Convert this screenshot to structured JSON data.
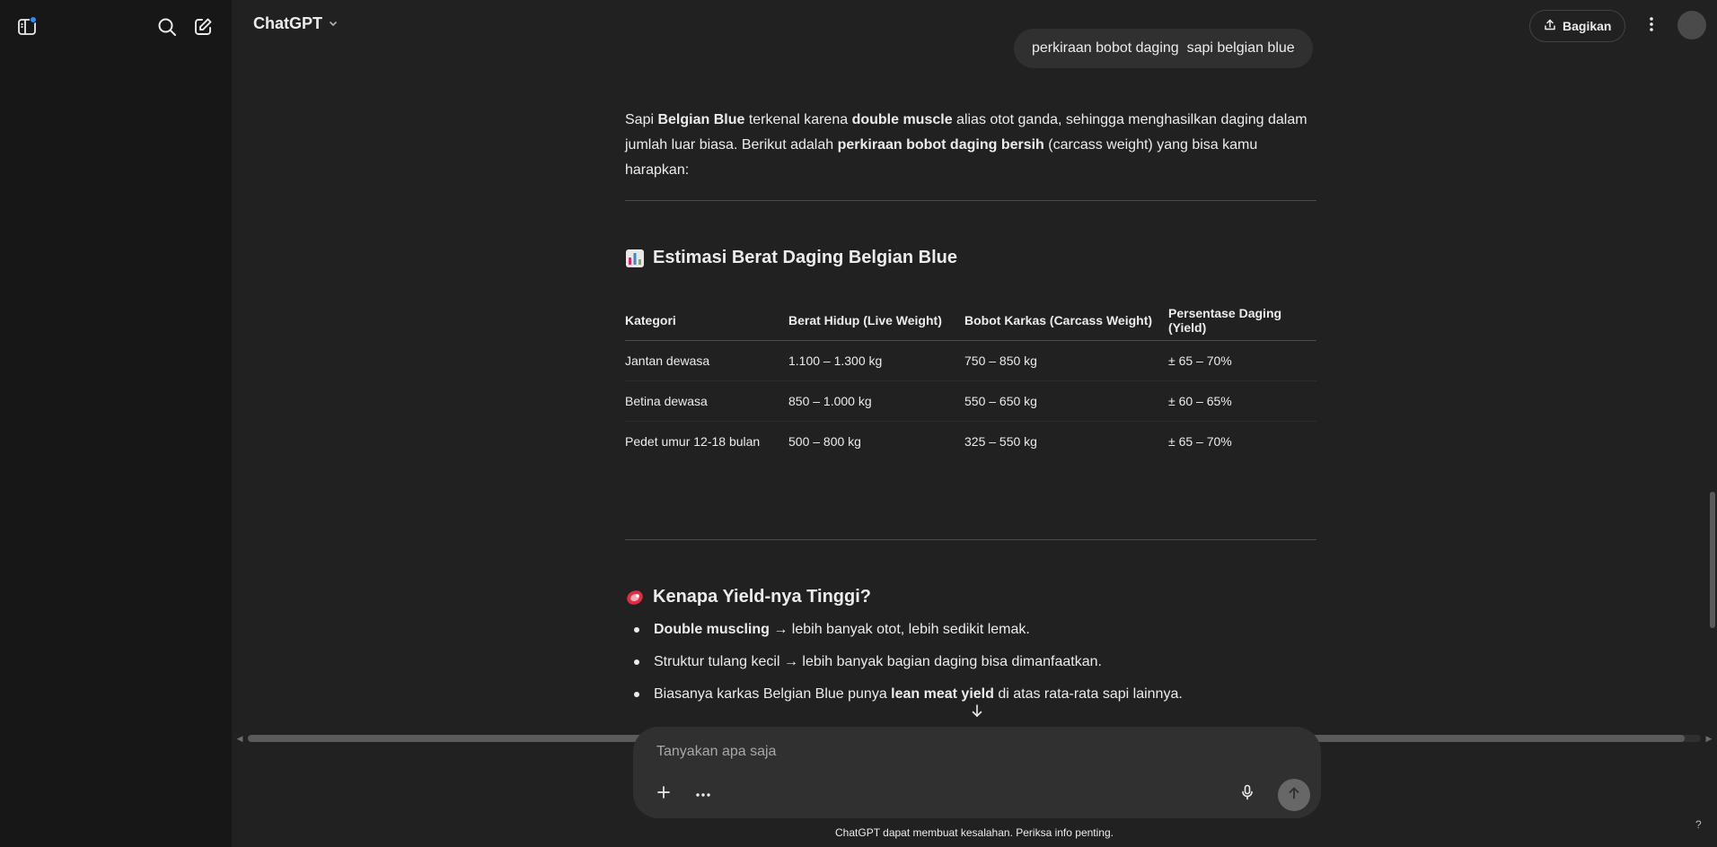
{
  "header": {
    "model_name": "ChatGPT",
    "share_label": "Bagikan"
  },
  "icons": {
    "sidebar_toggle": "sidebar-toggle-icon",
    "search": "search-icon",
    "new_chat": "new-chat-icon",
    "share": "share-icon",
    "more": "more-vertical-icon",
    "plus": "plus-icon",
    "tools": "more-horizontal-icon",
    "mic": "microphone-icon",
    "send": "arrow-up-icon"
  },
  "colors": {
    "background": "#212121",
    "sidebar": "#171717",
    "composer": "#303030",
    "notification_dot": "#2a8cff"
  },
  "user_message": "perkiraan bobot daging  sapi belgian blue",
  "assistant": {
    "intro": {
      "t1": "Sapi ",
      "b1": "Belgian Blue",
      "t2": " terkenal karena ",
      "b2": "double muscle",
      "t3": " alias otot ganda, sehingga menghasilkan daging dalam jumlah luar biasa. Berikut adalah ",
      "b3": "perkiraan bobot daging bersih",
      "t4": " (carcass weight) yang bisa kamu harapkan:"
    },
    "section1": {
      "emoji": "📊",
      "title": "Estimasi Berat Daging Belgian Blue"
    },
    "table": {
      "headers": [
        "Kategori",
        "Berat Hidup (Live Weight)",
        "Bobot Karkas (Carcass Weight)",
        "Persentase Daging (Yield)"
      ],
      "rows": [
        [
          "Jantan dewasa",
          "1.100 – 1.300 kg",
          "750 – 850 kg",
          "± 65 – 70%"
        ],
        [
          "Betina dewasa",
          "850 – 1.000 kg",
          "550 – 650 kg",
          "± 60 – 65%"
        ],
        [
          "Pedet umur 12-18 bulan",
          "500 – 800 kg",
          "325 – 550 kg",
          "± 65 – 70%"
        ]
      ]
    },
    "section2": {
      "emoji": "🥩",
      "title": "Kenapa Yield-nya Tinggi?"
    },
    "reasons": [
      {
        "bold": "Double muscling",
        "text": " → lebih banyak otot, lebih sedikit lemak."
      },
      {
        "pre": "Struktur tulang kecil → lebih banyak bagian daging bisa dimanfaatkan."
      },
      {
        "pre": "Biasanya karkas Belgian Blue punya ",
        "bold": "lean meat yield",
        "text": " di atas rata-rata sapi lainnya."
      }
    ]
  },
  "composer": {
    "placeholder": "Tanyakan apa saja"
  },
  "footer": {
    "disclaimer": "ChatGPT dapat membuat kesalahan. Periksa info penting.",
    "help": "?"
  }
}
